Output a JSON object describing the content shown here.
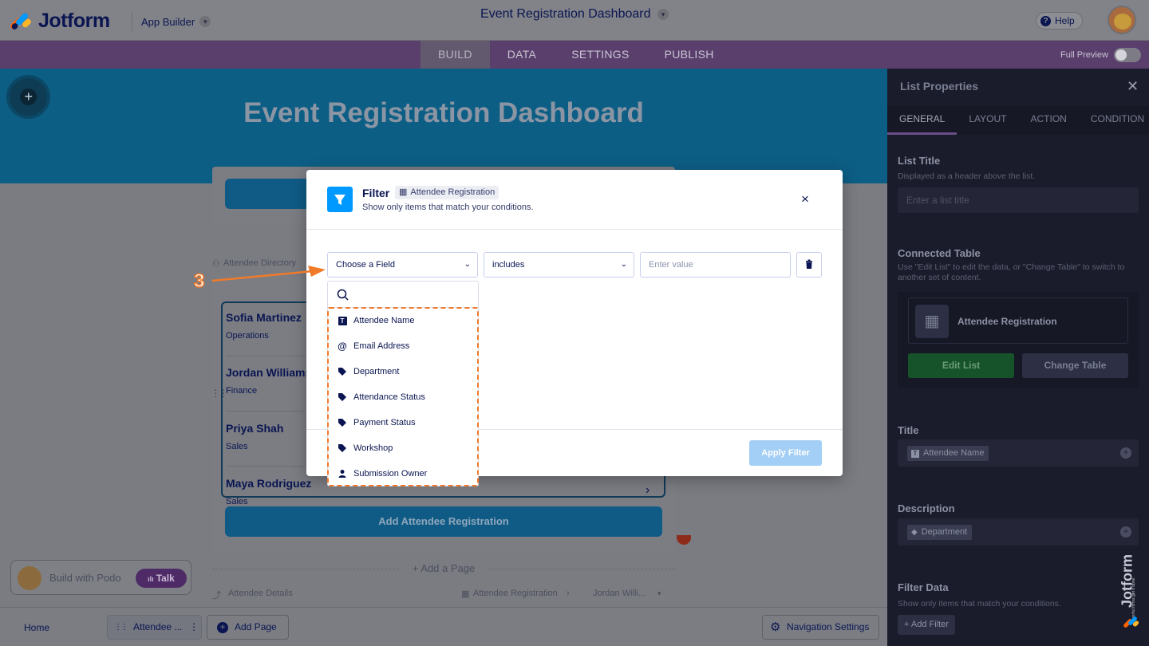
{
  "topbar": {
    "logo_text": "Jotform",
    "app_builder_label": "App Builder",
    "doc_title": "Event Registration Dashboard",
    "help_label": "Help"
  },
  "nav": {
    "tabs": [
      {
        "label": "BUILD",
        "active": true
      },
      {
        "label": "DATA",
        "active": false
      },
      {
        "label": "SETTINGS",
        "active": false
      },
      {
        "label": "PUBLISH",
        "active": false
      }
    ],
    "full_preview_label": "Full Preview",
    "full_preview_on": false
  },
  "canvas": {
    "hero_title": "Event Registration Dashboard",
    "plus_label": "+",
    "directory_label": "Attendee Directory",
    "list_items": [
      {
        "name": "Sofia Martinez",
        "department": "Operations"
      },
      {
        "name": "Jordan Williams",
        "department": "Finance"
      },
      {
        "name": "Priya Shah",
        "department": "Sales"
      },
      {
        "name": "Maya Rodriguez",
        "department": "Sales"
      }
    ],
    "add_registration_label": "Add Attendee Registration",
    "add_page_label": "+ Add a Page",
    "details_label": "Attendee Details",
    "details_table": "Attendee Registration",
    "details_record": "Jordan Willi..."
  },
  "podo": {
    "label": "Build with Podo",
    "talk_label": "Talk"
  },
  "bottombar": {
    "home_label": "Home",
    "attendee_label": "Attendee ...",
    "add_page_label": "Add Page",
    "nav_settings_label": "Navigation Settings"
  },
  "panel": {
    "title": "List Properties",
    "tabs": [
      {
        "label": "GENERAL",
        "active": true
      },
      {
        "label": "LAYOUT",
        "active": false
      },
      {
        "label": "ACTION",
        "active": false
      },
      {
        "label": "CONDITION",
        "active": false
      }
    ],
    "list_title_heading": "List Title",
    "list_title_desc": "Displayed as a header above the list.",
    "list_title_placeholder": "Enter a list title",
    "connected_heading": "Connected Table",
    "connected_desc": "Use \"Edit List\" to edit the data, or \"Change Table\" to switch to another set of content.",
    "table_name": "Attendee Registration",
    "edit_list_label": "Edit List",
    "change_table_label": "Change Table",
    "title_heading": "Title",
    "title_tag": "Attendee Name",
    "description_heading": "Description",
    "description_tag": "Department",
    "filter_heading": "Filter Data",
    "filter_desc": "Show only items that match your conditions.",
    "add_filter_label": "+ Add Filter",
    "brand_text": "Jotform",
    "brand_tagline": "Powerful forms get it done."
  },
  "modal": {
    "title": "Filter",
    "table_badge": "Attendee Registration",
    "subtitle": "Show only items that match your conditions.",
    "field_select": "Choose a Field",
    "operator_select": "includes",
    "value_placeholder": "Enter value",
    "apply_label": "Apply Filter",
    "close_label": "×"
  },
  "dropdown": {
    "options": [
      {
        "label": "Attendee Name",
        "icon": "text-icon"
      },
      {
        "label": "Email Address",
        "icon": "at-icon"
      },
      {
        "label": "Department",
        "icon": "tag-icon"
      },
      {
        "label": "Attendance Status",
        "icon": "tag-icon"
      },
      {
        "label": "Payment Status",
        "icon": "tag-icon"
      },
      {
        "label": "Workshop",
        "icon": "tag-icon"
      },
      {
        "label": "Submission Owner",
        "icon": "user-icon"
      }
    ]
  },
  "annotation": {
    "step_number": "3",
    "accent_color": "#f07a2a"
  }
}
